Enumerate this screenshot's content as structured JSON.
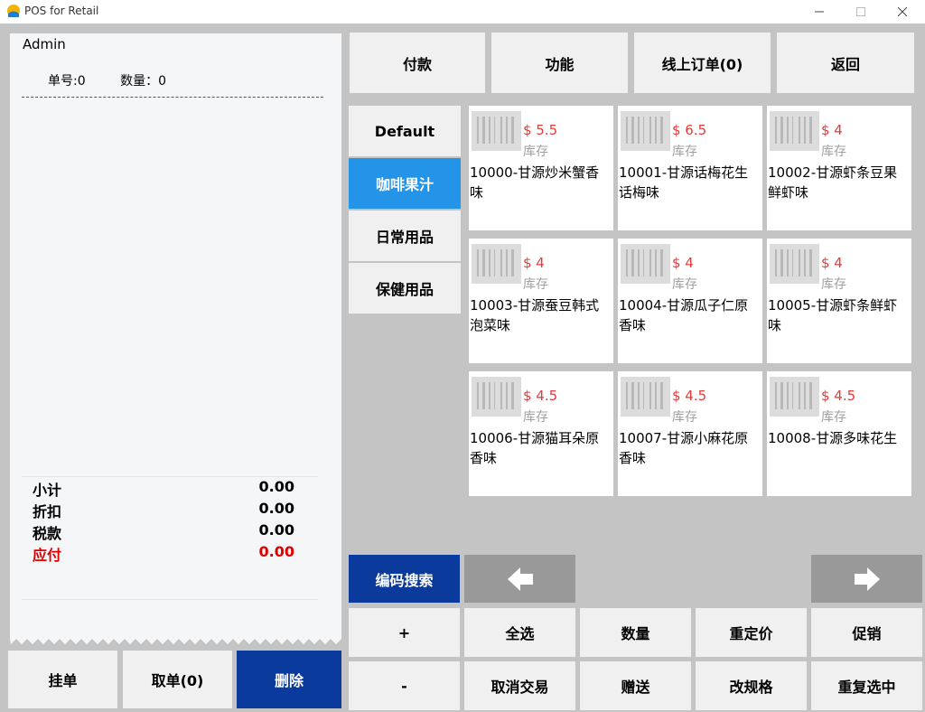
{
  "window": {
    "title": "POS for Retail",
    "controls": {
      "minimize": "—",
      "maximize": "☐",
      "close": "✕"
    }
  },
  "receipt": {
    "user": "Admin",
    "order_no_label": "单号:0",
    "quantity_label": "数量：0",
    "summary": [
      {
        "label": "小计",
        "value": "0.00"
      },
      {
        "label": "折扣",
        "value": "0.00"
      },
      {
        "label": "税款",
        "value": "0.00"
      },
      {
        "label": "应付",
        "value": "0.00"
      }
    ]
  },
  "bottom_left_buttons": {
    "hold": "挂单",
    "retrieve": "取单(0)",
    "delete": "删除"
  },
  "top_buttons": {
    "pay": "付款",
    "function": "功能",
    "online_orders": "线上订单(0)",
    "back": "返回"
  },
  "categories": [
    {
      "label": "Default",
      "selected": false
    },
    {
      "label": "咖啡果汁",
      "selected": true
    },
    {
      "label": "日常用品",
      "selected": false
    },
    {
      "label": "保健用品",
      "selected": false
    }
  ],
  "products": [
    {
      "price": "$ 5.5",
      "stock": "库存",
      "name": "10000-甘源炒米蟹香味"
    },
    {
      "price": "$ 6.5",
      "stock": "库存",
      "name": "10001-甘源话梅花生话梅味"
    },
    {
      "price": "$ 4",
      "stock": "库存",
      "name": "10002-甘源虾条豆果鲜虾味"
    },
    {
      "price": "$ 4",
      "stock": "库存",
      "name": "10003-甘源蚕豆韩式泡菜味"
    },
    {
      "price": "$ 4",
      "stock": "库存",
      "name": "10004-甘源瓜子仁原香味"
    },
    {
      "price": "$ 4",
      "stock": "库存",
      "name": "10005-甘源虾条鲜虾味"
    },
    {
      "price": "$ 4.5",
      "stock": "库存",
      "name": "10006-甘源猫耳朵原香味"
    },
    {
      "price": "$ 4.5",
      "stock": "库存",
      "name": "10007-甘源小麻花原香味"
    },
    {
      "price": "$ 4.5",
      "stock": "库存",
      "name": "10008-甘源多味花生"
    }
  ],
  "nav": {
    "code_search": "编码搜索",
    "prev_icon": "arrow-left-icon",
    "next_icon": "arrow-right-icon"
  },
  "action_row1": {
    "plus": "+",
    "select_all": "全选",
    "quantity": "数量",
    "reprice": "重定价",
    "promotion": "促销"
  },
  "action_row2": {
    "minus": "-",
    "cancel_transaction": "取消交易",
    "gift": "赠送",
    "change_spec": "改规格",
    "reselect": "重复选中"
  },
  "colors": {
    "accent_blue": "#0a3b9c",
    "category_selected": "#2394e8",
    "price_red": "#e23b3b",
    "due_red": "#e00000",
    "background": "#c4c4c4"
  }
}
